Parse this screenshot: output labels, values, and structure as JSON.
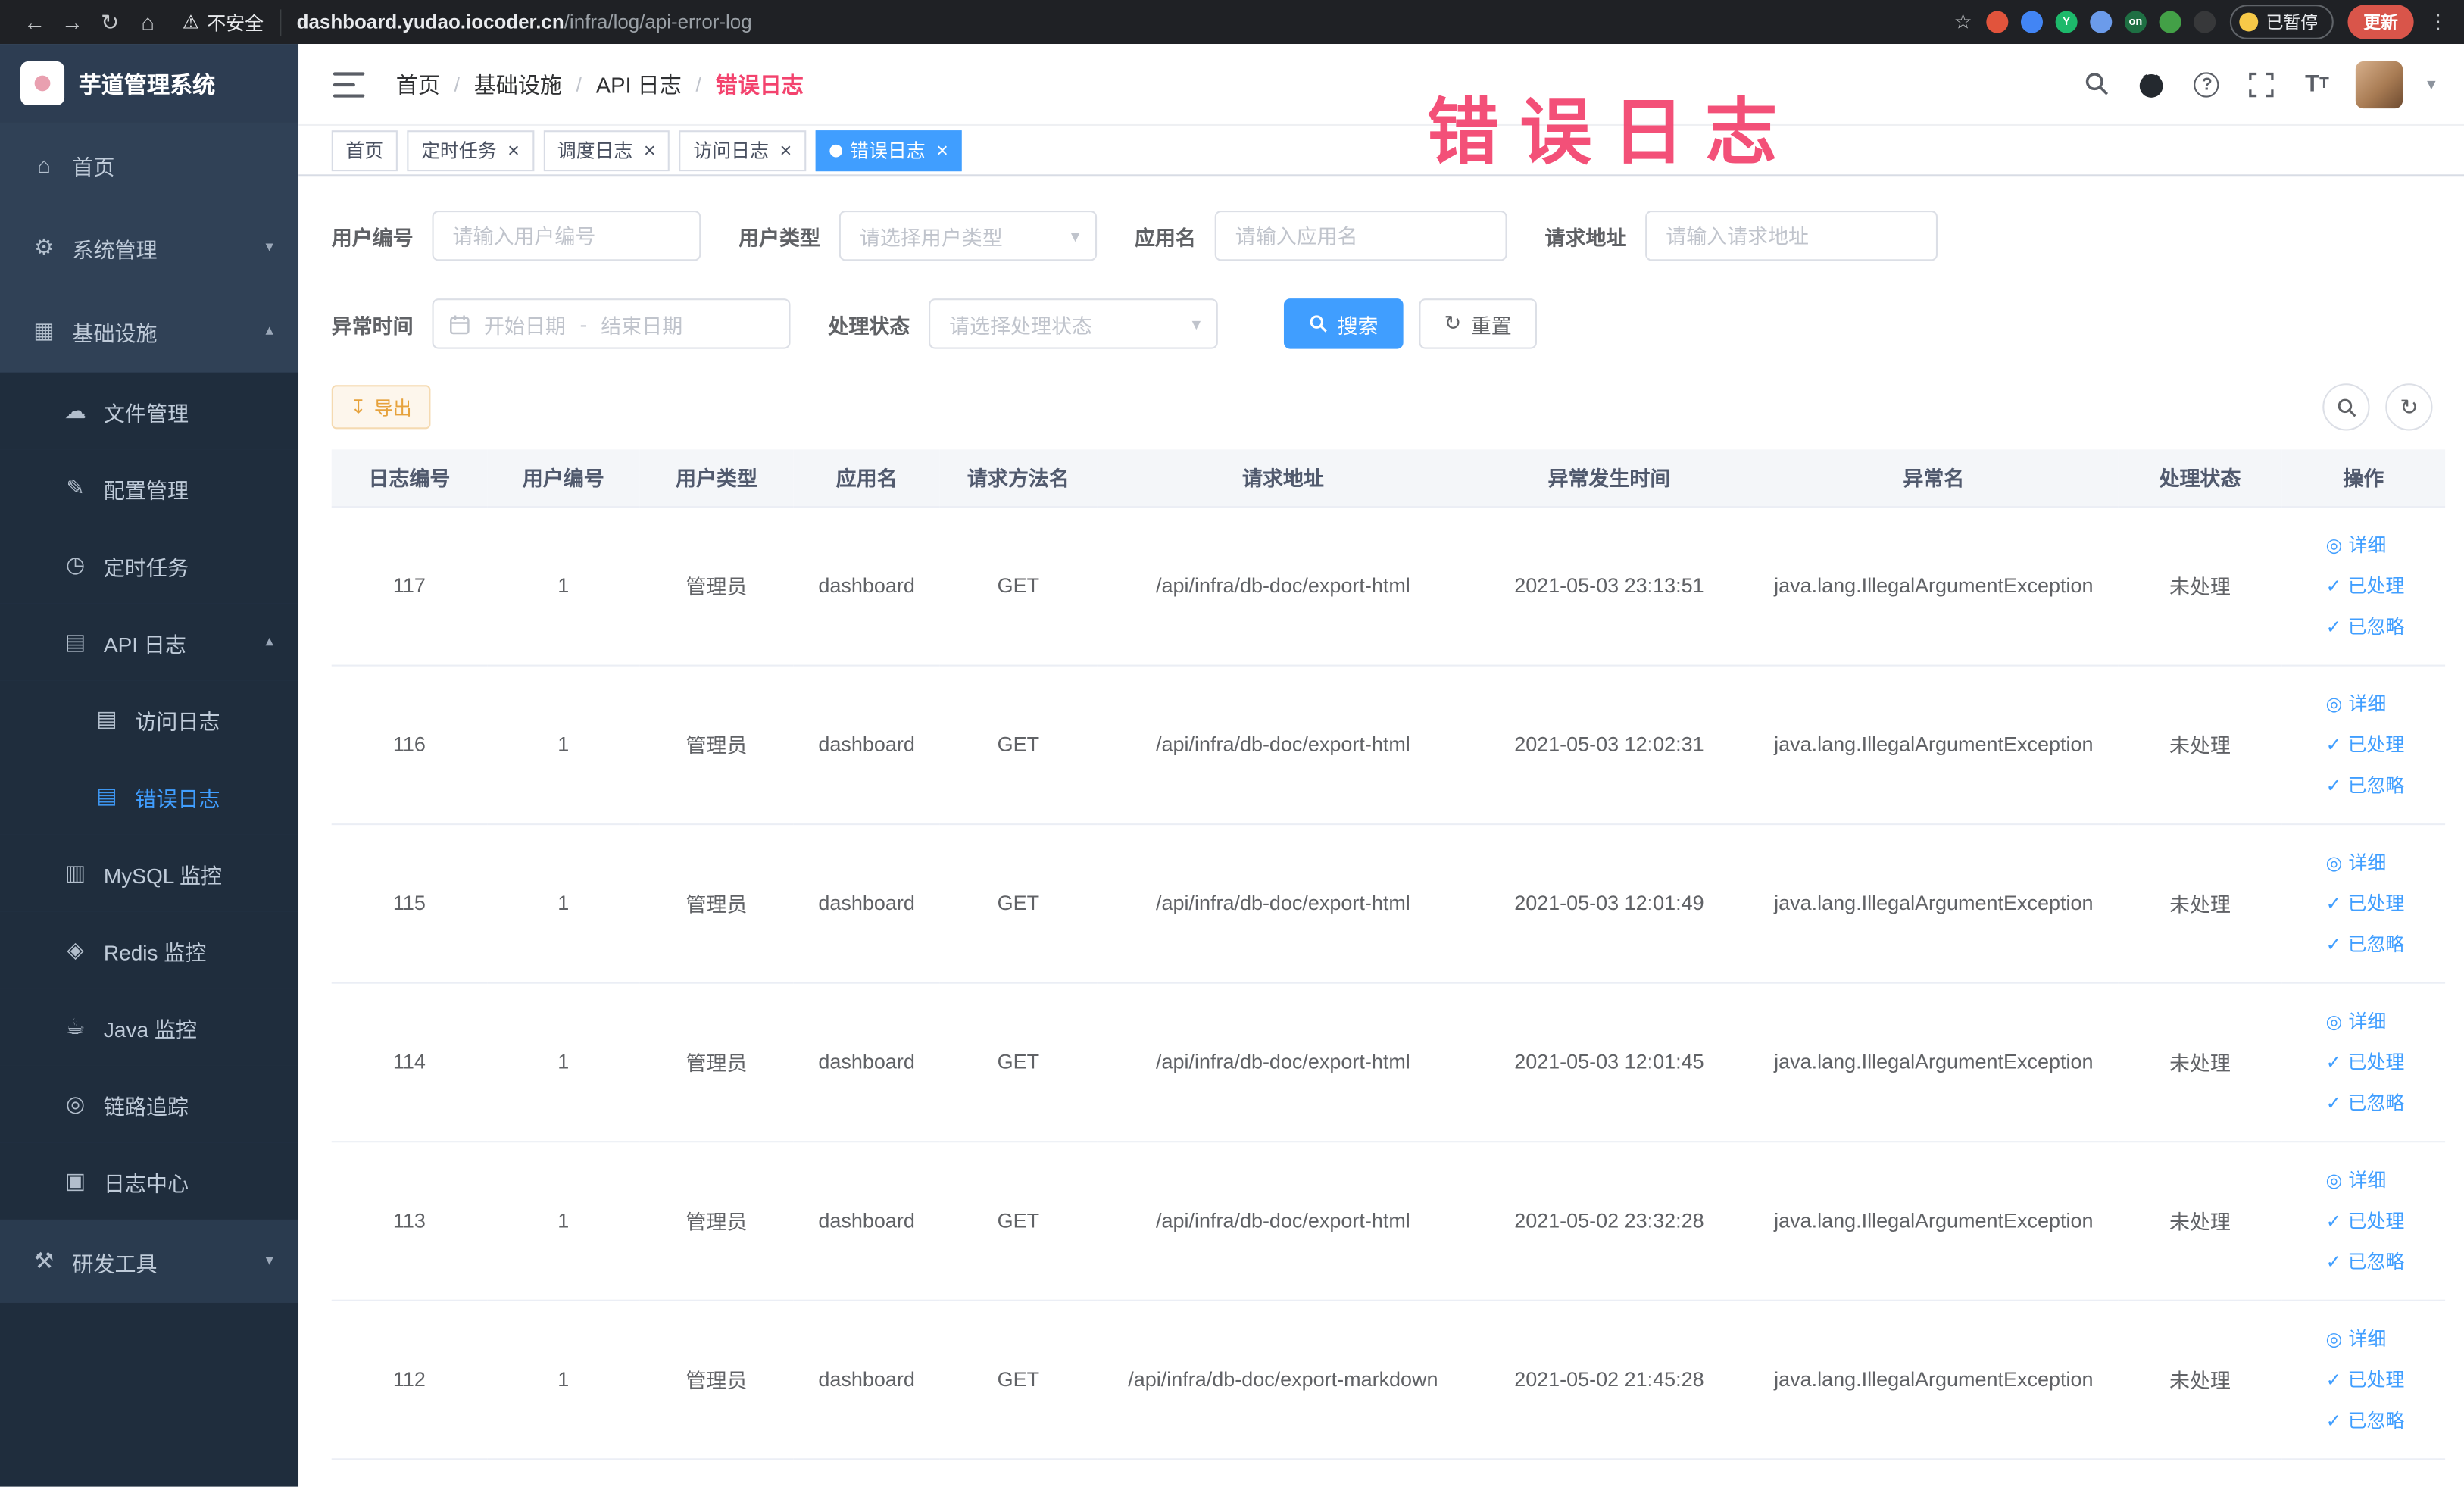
{
  "browser": {
    "security_label": "不安全",
    "url_domain": "dashboard.yudao.iocoder.cn",
    "url_path": "/infra/log/api-error-log",
    "paused_badge": "已暂停",
    "update_button": "更新",
    "extensions": [
      {
        "name": "extension-target-icon",
        "color": "#e1543c",
        "label": ""
      },
      {
        "name": "extension-drop-icon",
        "color": "#4285f4",
        "label": ""
      },
      {
        "name": "extension-y-icon",
        "color": "#1db96b",
        "label": "Y"
      },
      {
        "name": "extension-grid-icon",
        "color": "#6b9bea",
        "label": ""
      },
      {
        "name": "extension-on-icon",
        "color": "#1e6f43",
        "label": "on"
      },
      {
        "name": "extension-leaf-icon",
        "color": "#43a047",
        "label": ""
      },
      {
        "name": "extension-paw-icon",
        "color": "#37383a",
        "label": ""
      }
    ]
  },
  "annotation": {
    "overlay_text": "错误日志"
  },
  "sidebar": {
    "logo_title": "芋道管理系统",
    "items": [
      {
        "label": "首页",
        "icon": "home-icon",
        "glyph": "⌂",
        "level": 0
      },
      {
        "label": "系统管理",
        "icon": "gear-icon",
        "glyph": "⚙",
        "level": 0,
        "chevron": "down"
      },
      {
        "label": "基础设施",
        "icon": "infra-icon",
        "glyph": "▦",
        "level": 0,
        "chevron": "up"
      },
      {
        "label": "文件管理",
        "icon": "file-cloud-icon",
        "glyph": "☁",
        "level": 1,
        "sub": true
      },
      {
        "label": "配置管理",
        "icon": "config-edit-icon",
        "glyph": "✎",
        "level": 1,
        "sub": true
      },
      {
        "label": "定时任务",
        "icon": "cron-clock-icon",
        "glyph": "◷",
        "level": 1,
        "sub": true
      },
      {
        "label": "API 日志",
        "icon": "api-log-icon",
        "glyph": "▤",
        "level": 1,
        "sub": true,
        "chevron": "up"
      },
      {
        "label": "访问日志",
        "icon": "access-log-icon",
        "glyph": "▤",
        "level": 2,
        "sub": true
      },
      {
        "label": "错误日志",
        "icon": "error-log-icon",
        "glyph": "▤",
        "level": 2,
        "sub": true,
        "active": true
      },
      {
        "label": "MySQL 监控",
        "icon": "mysql-icon",
        "glyph": "▥",
        "level": 1,
        "sub": true
      },
      {
        "label": "Redis 监控",
        "icon": "redis-icon",
        "glyph": "◈",
        "level": 1,
        "sub": true
      },
      {
        "label": "Java 监控",
        "icon": "java-icon",
        "glyph": "☕",
        "level": 1,
        "sub": true
      },
      {
        "label": "链路追踪",
        "icon": "trace-icon",
        "glyph": "◎",
        "level": 1,
        "sub": true
      },
      {
        "label": "日志中心",
        "icon": "log-center-icon",
        "glyph": "▣",
        "level": 1,
        "sub": true
      },
      {
        "label": "研发工具",
        "icon": "devtools-icon",
        "glyph": "⚒",
        "level": 0,
        "chevron": "down",
        "footer": true
      }
    ]
  },
  "navbar": {
    "breadcrumb": [
      "首页",
      "基础设施",
      "API 日志",
      "错误日志"
    ]
  },
  "tabs": [
    {
      "label": "首页",
      "closable": false,
      "active": false
    },
    {
      "label": "定时任务",
      "closable": true,
      "active": false
    },
    {
      "label": "调度日志",
      "closable": true,
      "active": false
    },
    {
      "label": "访问日志",
      "closable": true,
      "active": false
    },
    {
      "label": "错误日志",
      "closable": true,
      "active": true
    }
  ],
  "filters": {
    "user_id": {
      "label": "用户编号",
      "placeholder": "请输入用户编号"
    },
    "user_type": {
      "label": "用户类型",
      "placeholder": "请选择用户类型"
    },
    "app_name": {
      "label": "应用名",
      "placeholder": "请输入应用名"
    },
    "request_url": {
      "label": "请求地址",
      "placeholder": "请输入请求地址"
    },
    "exception_time": {
      "label": "异常时间",
      "start_placeholder": "开始日期",
      "separator": "-",
      "end_placeholder": "结束日期"
    },
    "process_status": {
      "label": "处理状态",
      "placeholder": "请选择处理状态"
    },
    "search_button": "搜索",
    "reset_button": "重置"
  },
  "toolbar": {
    "export_label": "导出"
  },
  "table": {
    "columns": [
      "日志编号",
      "用户编号",
      "用户类型",
      "应用名",
      "请求方法名",
      "请求地址",
      "异常发生时间",
      "异常名",
      "处理状态",
      "操作"
    ],
    "action_labels": {
      "detail": "详细",
      "processed": "已处理",
      "ignored": "已忽略"
    },
    "rows": [
      {
        "id": "117",
        "user_id": "1",
        "user_type": "管理员",
        "app": "dashboard",
        "method": "GET",
        "url": "/api/infra/db-doc/export-html",
        "time": "2021-05-03 23:13:51",
        "exception": "java.lang.IllegalArgumentException",
        "status": "未处理"
      },
      {
        "id": "116",
        "user_id": "1",
        "user_type": "管理员",
        "app": "dashboard",
        "method": "GET",
        "url": "/api/infra/db-doc/export-html",
        "time": "2021-05-03 12:02:31",
        "exception": "java.lang.IllegalArgumentException",
        "status": "未处理"
      },
      {
        "id": "115",
        "user_id": "1",
        "user_type": "管理员",
        "app": "dashboard",
        "method": "GET",
        "url": "/api/infra/db-doc/export-html",
        "time": "2021-05-03 12:01:49",
        "exception": "java.lang.IllegalArgumentException",
        "status": "未处理"
      },
      {
        "id": "114",
        "user_id": "1",
        "user_type": "管理员",
        "app": "dashboard",
        "method": "GET",
        "url": "/api/infra/db-doc/export-html",
        "time": "2021-05-03 12:01:45",
        "exception": "java.lang.IllegalArgumentException",
        "status": "未处理"
      },
      {
        "id": "113",
        "user_id": "1",
        "user_type": "管理员",
        "app": "dashboard",
        "method": "GET",
        "url": "/api/infra/db-doc/export-html",
        "time": "2021-05-02 23:32:28",
        "exception": "java.lang.IllegalArgumentException",
        "status": "未处理"
      },
      {
        "id": "112",
        "user_id": "1",
        "user_type": "管理员",
        "app": "dashboard",
        "method": "GET",
        "url": "/api/infra/db-doc/export-markdown",
        "time": "2021-05-02 21:45:28",
        "exception": "java.lang.IllegalArgumentException",
        "status": "未处理"
      }
    ]
  },
  "colors": {
    "primary": "#409eff",
    "annotation_pink": "#f3436e",
    "warning": "#e6a23c"
  }
}
